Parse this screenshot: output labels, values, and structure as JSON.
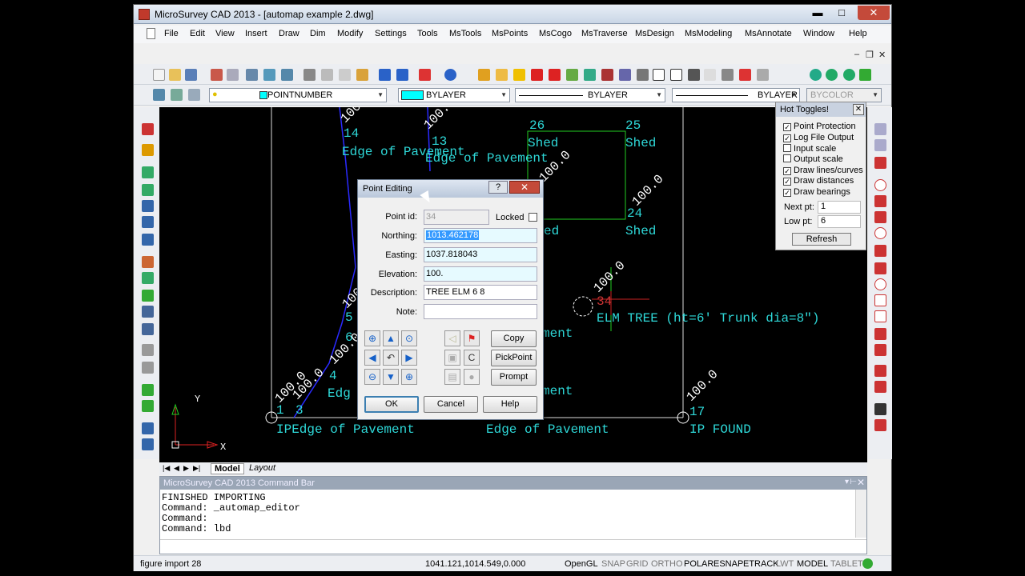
{
  "window": {
    "title": "MicroSurvey CAD 2013 - [automap example 2.dwg]",
    "min": "▬",
    "max": "□",
    "close": "✕"
  },
  "menu": [
    "File",
    "Edit",
    "View",
    "Insert",
    "Draw",
    "Dim",
    "Modify",
    "Settings",
    "Tools",
    "MsTools",
    "MsPoints",
    "MsCogo",
    "MsTraverse",
    "MsDesign",
    "MsModeling",
    "MsAnnotate",
    "Window",
    "Help"
  ],
  "mdi": {
    "min": "–",
    "restore": "❐",
    "close": "✕"
  },
  "toolbar2": {
    "layer": "POINTNUMBER",
    "color": "BYLAYER",
    "linetype": "BYLAYER",
    "lineweight": "BYLAYER",
    "plotstyle": "BYCOLOR",
    "color_swatch": "#00ffff"
  },
  "drawing": {
    "labels": [
      {
        "text": "14"
      },
      {
        "text": "Edge of Pavement"
      },
      {
        "text": "13"
      },
      {
        "text": "Edge of Pavement"
      },
      {
        "text": "26"
      },
      {
        "text": "25"
      },
      {
        "text": "Shed"
      },
      {
        "text": "Shed"
      },
      {
        "text": "24"
      },
      {
        "text": "Shed"
      },
      {
        "text": "ed"
      },
      {
        "text": "34"
      },
      {
        "text": "ELM TREE (ht=6' Trunk dia=8\")"
      },
      {
        "text": "5"
      },
      {
        "text": "6"
      },
      {
        "text": "4"
      },
      {
        "text": "Edg"
      },
      {
        "text": "ment"
      },
      {
        "text": "ment"
      },
      {
        "text": "1"
      },
      {
        "text": "3"
      },
      {
        "text": "IPEdge of Pavement"
      },
      {
        "text": "Edge of Pavement"
      },
      {
        "text": "17"
      },
      {
        "text": "IP FOUND"
      }
    ],
    "elevations": [
      "100.",
      "100.",
      "100.0",
      "100.0",
      "100.0",
      "100.0",
      "100.0",
      "100.0",
      "100.0",
      "100.0"
    ],
    "axis_x": "X",
    "axis_y": "Y"
  },
  "tabs": [
    "Model",
    "Layout"
  ],
  "cmdbar": {
    "title": "MicroSurvey CAD 2013 Command Bar",
    "lines": [
      "FINISHED IMPORTING",
      "Command: _automap_editor",
      "Command:",
      "Command: lbd"
    ]
  },
  "status": {
    "left": "figure import 28",
    "coords": "1041.121,1014.549,0.000",
    "toggles": [
      {
        "label": "OpenGL",
        "on": true
      },
      {
        "label": "SNAP",
        "on": false
      },
      {
        "label": "GRID",
        "on": false
      },
      {
        "label": "ORTHO",
        "on": false
      },
      {
        "label": "POLAR",
        "on": true
      },
      {
        "label": "ESNAP",
        "on": true
      },
      {
        "label": "ETRACK",
        "on": true
      },
      {
        "label": "LWT",
        "on": false
      },
      {
        "label": "MODEL",
        "on": true
      },
      {
        "label": "TABLET",
        "on": false
      }
    ]
  },
  "hot_toggles": {
    "title": "Hot Toggles!",
    "items": [
      {
        "label": "Point Protection",
        "checked": true
      },
      {
        "label": "Log File Output",
        "checked": true
      },
      {
        "label": "Input scale",
        "checked": false
      },
      {
        "label": "Output scale",
        "checked": false
      },
      {
        "label": "Draw lines/curves",
        "checked": true
      },
      {
        "label": "Draw distances",
        "checked": true
      },
      {
        "label": "Draw bearings",
        "checked": true
      }
    ],
    "next_pt_label": "Next pt:",
    "next_pt": "1",
    "low_pt_label": "Low pt:",
    "low_pt": "6",
    "refresh": "Refresh"
  },
  "dialog": {
    "title": "Point Editing",
    "help": "?",
    "close": "✕",
    "point_id_label": "Point id:",
    "point_id": "34",
    "locked_label": "Locked",
    "northing_label": "Northing:",
    "northing": "1013.462178",
    "easting_label": "Easting:",
    "easting": "1037.818043",
    "elevation_label": "Elevation:",
    "elevation": "100.",
    "description_label": "Description:",
    "description": "TREE ELM 6 8",
    "note_label": "Note:",
    "note": "",
    "copy": "Copy",
    "pickpoint": "PickPoint",
    "prompt": "Prompt",
    "ok": "OK",
    "cancel": "Cancel",
    "help_btn": "Help"
  }
}
